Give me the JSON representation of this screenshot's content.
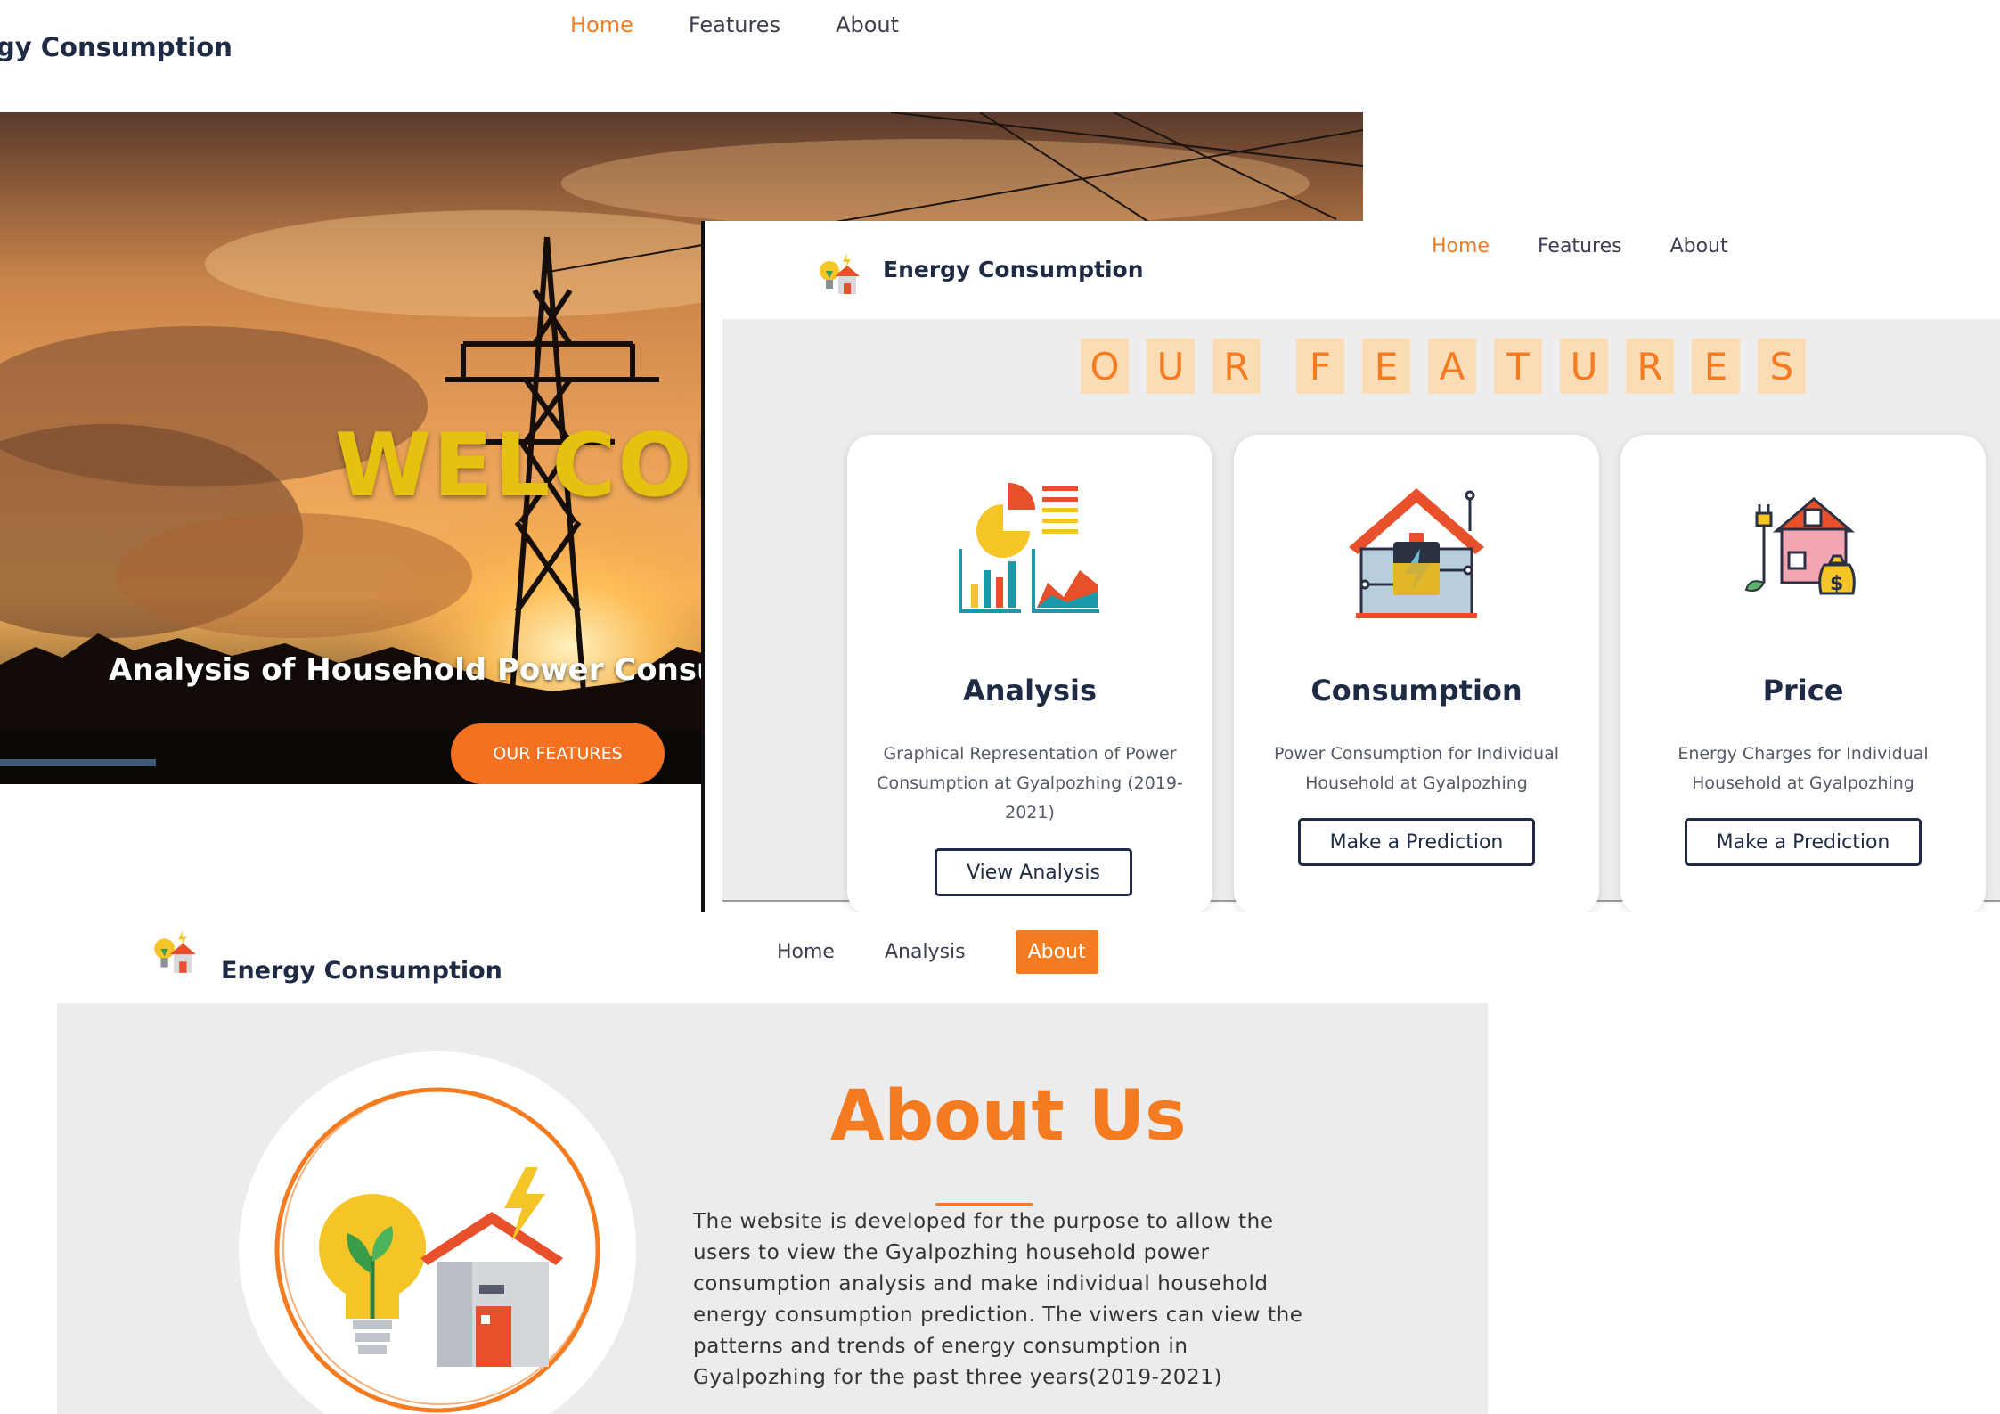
{
  "home_page": {
    "brand": "gy Consumption",
    "nav": [
      "Home",
      "Features",
      "About"
    ],
    "active_nav": "Home",
    "hero": {
      "heading": "WELCOM",
      "subtitle": "Analysis of Household Power Consump",
      "cta_label": "OUR FEATURES"
    }
  },
  "features_page": {
    "brand": "Energy Consumption",
    "nav": [
      "Home",
      "Features",
      "About"
    ],
    "active_nav": "Home",
    "heading_letters": [
      "O",
      "U",
      "R",
      "F",
      "E",
      "A",
      "T",
      "U",
      "R",
      "E",
      "S"
    ],
    "cards": [
      {
        "title": "Analysis",
        "description": "Graphical Representation of Power Consumption at Gyalpozhing (2019-2021)",
        "button": "View Analysis",
        "icon": "analysis-chart-icon"
      },
      {
        "title": "Consumption",
        "description": "Power Consumption for Individual Household at Gyalpozhing",
        "button": "Make a Prediction",
        "icon": "house-energy-icon"
      },
      {
        "title": "Price",
        "description": "Energy Charges for Individual Household at Gyalpozhing",
        "button": "Make a Prediction",
        "icon": "house-price-icon"
      }
    ]
  },
  "about_page": {
    "brand": "Energy Consumption",
    "nav": [
      "Home",
      "Analysis",
      "About"
    ],
    "active_nav": "About",
    "title": "About Us",
    "paragraph": "The website is developed for the purpose to allow the users to view the Gyalpozhing household power consumption analysis and make individual household energy consumption prediction. The viwers can view the patterns and trends of energy consumption in Gyalpozhing for the past three years(2019-2021)"
  },
  "colors": {
    "accent": "#f47b20",
    "navy": "#1f2a44",
    "welcome_yellow": "#e6c210",
    "tile_bg": "#fcdcb4"
  }
}
